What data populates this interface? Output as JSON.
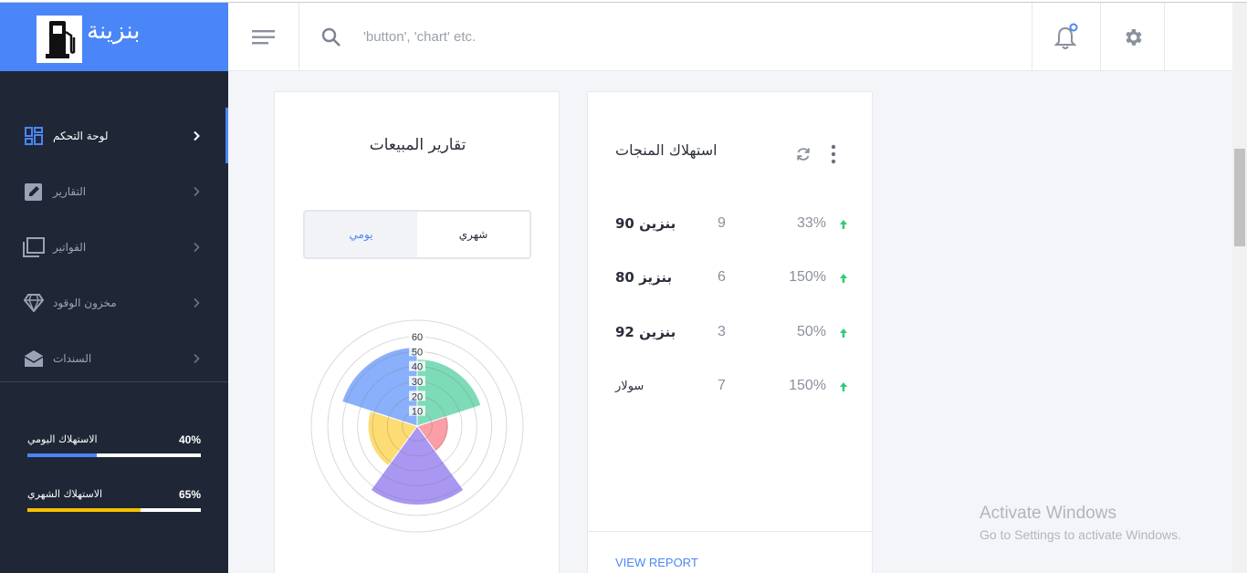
{
  "brand": {
    "title": "بنزينة"
  },
  "header": {
    "search_placeholder": "'button', 'chart' etc.",
    "menu_icon": "hamburger-icon",
    "search_icon": "search-icon",
    "bell_icon": "bell-icon",
    "gear_icon": "gear-icon"
  },
  "sidebar": {
    "items": [
      {
        "label": "لوحة التحكم",
        "icon": "dashboard-grid-icon",
        "active": true
      },
      {
        "label": "التقارير",
        "icon": "edit-report-icon",
        "active": false
      },
      {
        "label": "الفواتير",
        "icon": "invoices-stack-icon",
        "active": false
      },
      {
        "label": "مخزون الوقود",
        "icon": "diamond-icon",
        "active": false
      },
      {
        "label": "السندات",
        "icon": "envelope-icon",
        "active": false
      }
    ],
    "progress": [
      {
        "label": "الاستهلاك اليومي",
        "value_text": "40%",
        "value": 40,
        "color": "#4a86f7"
      },
      {
        "label": "الاستهلاك الشهري",
        "value_text": "65%",
        "value": 65,
        "color": "#f7c000"
      }
    ]
  },
  "sales_card": {
    "title": "تقارير المبيعات",
    "toggle": {
      "daily": "يومي",
      "monthly": "شهري",
      "selected": "daily"
    }
  },
  "chart_data": {
    "type": "polarArea",
    "title": "",
    "r_ticks": [
      "10",
      "20",
      "30",
      "40",
      "50",
      "60"
    ],
    "r_max": 60,
    "grid": true,
    "segments": [
      {
        "value": 45,
        "color": "#7ddcb7"
      },
      {
        "value": 21,
        "color": "#fb9ea6"
      },
      {
        "value": 53,
        "color": "#a997f2"
      },
      {
        "value": 33,
        "color": "#fddc73"
      },
      {
        "value": 53,
        "color": "#8ab0fb"
      }
    ]
  },
  "consumption_card": {
    "title": "استهلاك المنجات",
    "refresh_icon": "refresh-icon",
    "more_icon": "more-vertical-icon",
    "rows": [
      {
        "name": "بنزين 90",
        "count": "9",
        "percent": "33%"
      },
      {
        "name": "بنزيز 80",
        "count": "6",
        "percent": "150%"
      },
      {
        "name": "بنزين 92",
        "count": "3",
        "percent": "50%"
      },
      {
        "name": "سولار",
        "count": "7",
        "percent": "150%"
      }
    ],
    "trend_color": "#2ecc71",
    "report_link": "VIEW REPORT"
  },
  "watermark": {
    "line1": "Activate Windows",
    "line2": "Go to Settings to activate Windows."
  }
}
